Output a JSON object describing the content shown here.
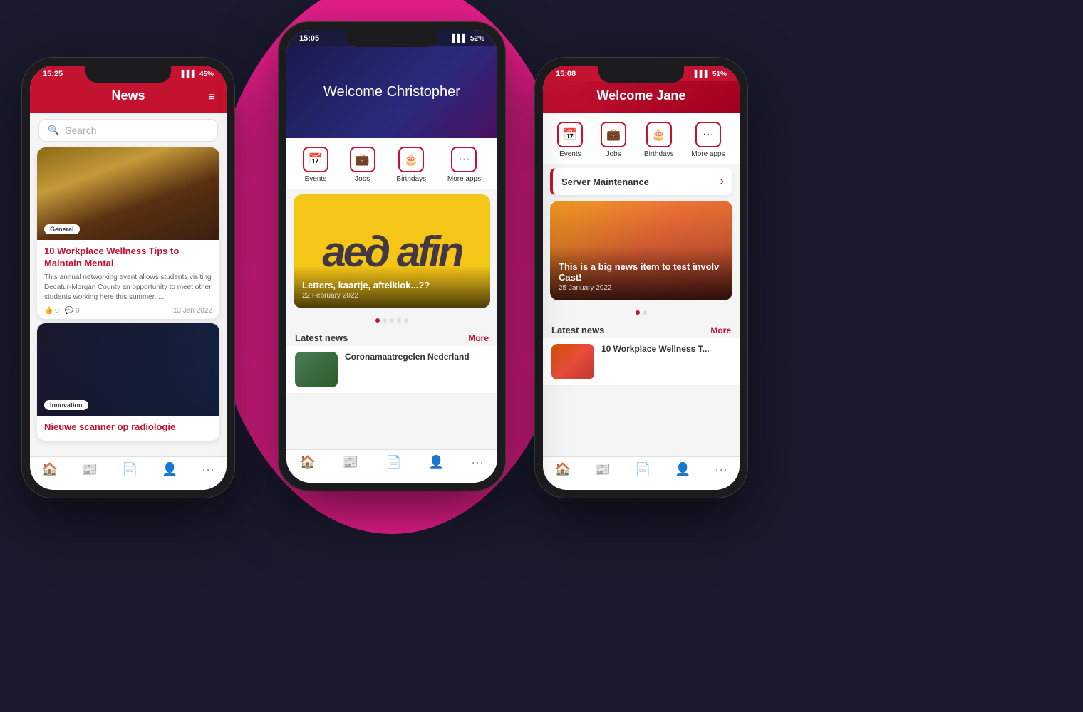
{
  "scene": {
    "background": "#1a1a2e"
  },
  "phones": {
    "left": {
      "time": "15:25",
      "battery": "45%",
      "header": {
        "title": "News",
        "filter_icon": "≡"
      },
      "search": {
        "placeholder": "Search"
      },
      "card1": {
        "badge": "General",
        "title": "10 Workplace Wellness Tips to Maintain Mental",
        "description": "This annual networking event allows students visiting Decatur-Morgan County an opportunity to meet other students working here this summer. ...",
        "likes": "0",
        "comments": "0",
        "date": "13 Jan 2022"
      },
      "card2": {
        "badge": "Innovation",
        "title": "Nieuwe scanner op radiologie"
      },
      "nav": {
        "items": [
          "🏠",
          "📰",
          "📄",
          "👤",
          "···"
        ]
      }
    },
    "center": {
      "time": "15:05",
      "battery": "52%",
      "welcome": "Welcome Christopher",
      "quick_actions": [
        {
          "label": "Events",
          "icon": "📅"
        },
        {
          "label": "Jobs",
          "icon": "💼"
        },
        {
          "label": "Birthdays",
          "icon": "🎂"
        },
        {
          "label": "More apps",
          "icon": "···"
        }
      ],
      "featured": {
        "text": "aed afin",
        "title": "Letters, kaartje, aftelklok...??",
        "date": "22 February 2022"
      },
      "latest_news": {
        "label": "Latest news",
        "more": "More",
        "items": [
          {
            "title": "Coronamaatregelen Nederland"
          }
        ]
      },
      "nav": {
        "items": [
          "🏠",
          "📰",
          "📄",
          "👤",
          "···"
        ]
      }
    },
    "right": {
      "time": "15:08",
      "battery": "51%",
      "welcome": "Welcome Jane",
      "alert": {
        "title": "Server Maintenance"
      },
      "featured": {
        "title": "This is a big news item to test involv Cast!",
        "date": "25 January 2022"
      },
      "latest_news": {
        "label": "Latest news",
        "more": "More",
        "items": [
          {
            "title": "10 Workplace Wellness T..."
          }
        ]
      },
      "quick_actions": [
        {
          "label": "Events",
          "icon": "📅"
        },
        {
          "label": "Jobs",
          "icon": "💼"
        },
        {
          "label": "Birthdays",
          "icon": "🎂"
        },
        {
          "label": "More apps",
          "icon": "···"
        }
      ],
      "nav": {
        "items": [
          "🏠",
          "📰",
          "📄",
          "👤",
          "···"
        ]
      }
    }
  }
}
